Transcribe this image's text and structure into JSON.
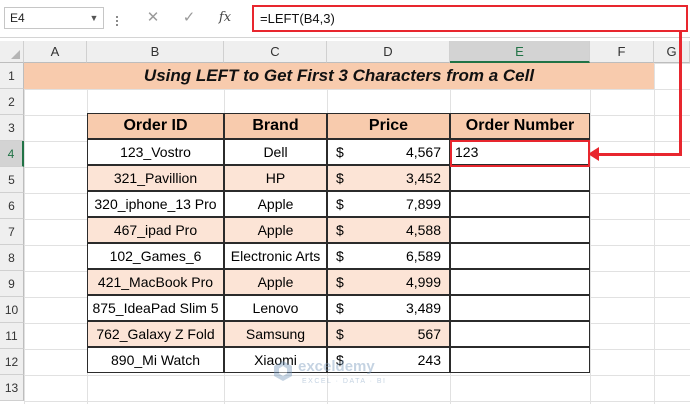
{
  "formula_bar": {
    "name_box": "E4",
    "cancel_icon": "✕",
    "enter_icon": "✓",
    "fx_label": "fx",
    "formula": "=LEFT(B4,3)"
  },
  "columns": [
    "A",
    "B",
    "C",
    "D",
    "E",
    "F",
    "G"
  ],
  "selected_column": "E",
  "rows": [
    "1",
    "2",
    "3",
    "4",
    "5",
    "6",
    "7",
    "8",
    "9",
    "10",
    "11",
    "12",
    "13"
  ],
  "selected_row": "4",
  "title": "Using LEFT to Get First 3 Characters from a Cell",
  "table": {
    "headers": [
      "Order ID",
      "Brand",
      "Price",
      "Order Number"
    ],
    "currency_symbol": "$",
    "rows": [
      {
        "order_id": "123_Vostro",
        "brand": "Dell",
        "price": "4,567",
        "order_number": "123"
      },
      {
        "order_id": "321_Pavillion",
        "brand": "HP",
        "price": "3,452",
        "order_number": ""
      },
      {
        "order_id": "320_iphone_13 Pro",
        "brand": "Apple",
        "price": "7,899",
        "order_number": ""
      },
      {
        "order_id": "467_ipad Pro",
        "brand": "Apple",
        "price": "4,588",
        "order_number": ""
      },
      {
        "order_id": "102_Games_6",
        "brand": "Electronic Arts",
        "price": "6,589",
        "order_number": ""
      },
      {
        "order_id": "421_MacBook Pro",
        "brand": "Apple",
        "price": "4,999",
        "order_number": ""
      },
      {
        "order_id": "875_IdeaPad Slim 5",
        "brand": "Lenovo",
        "price": "3,489",
        "order_number": ""
      },
      {
        "order_id": "762_Galaxy Z Fold",
        "brand": "Samsung",
        "price": "567",
        "order_number": ""
      },
      {
        "order_id": "890_Mi Watch",
        "brand": "Xiaomi",
        "price": "243",
        "order_number": ""
      }
    ]
  },
  "watermark": {
    "name": "exceldemy",
    "tagline": "EXCEL · DATA · BI"
  },
  "colors": {
    "accent_red": "#e8262e",
    "title_fill": "#f8cbad",
    "band_fill": "#fce4d6",
    "excel_green": "#217346"
  }
}
